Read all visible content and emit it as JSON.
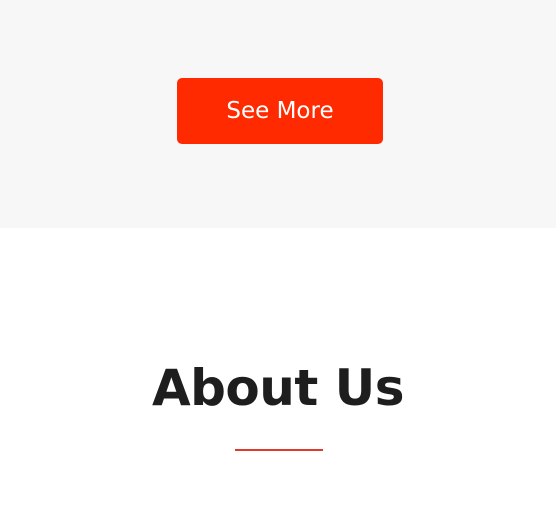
{
  "top_section": {
    "cta_label": "See More"
  },
  "about_section": {
    "title": "About Us"
  },
  "colors": {
    "top_background": "#f7f7f7",
    "button_background": "#ff2a00",
    "button_text": "#ffffff",
    "title_text": "#1e1e1e",
    "divider": "#e2392a",
    "page_background": "#ffffff"
  }
}
